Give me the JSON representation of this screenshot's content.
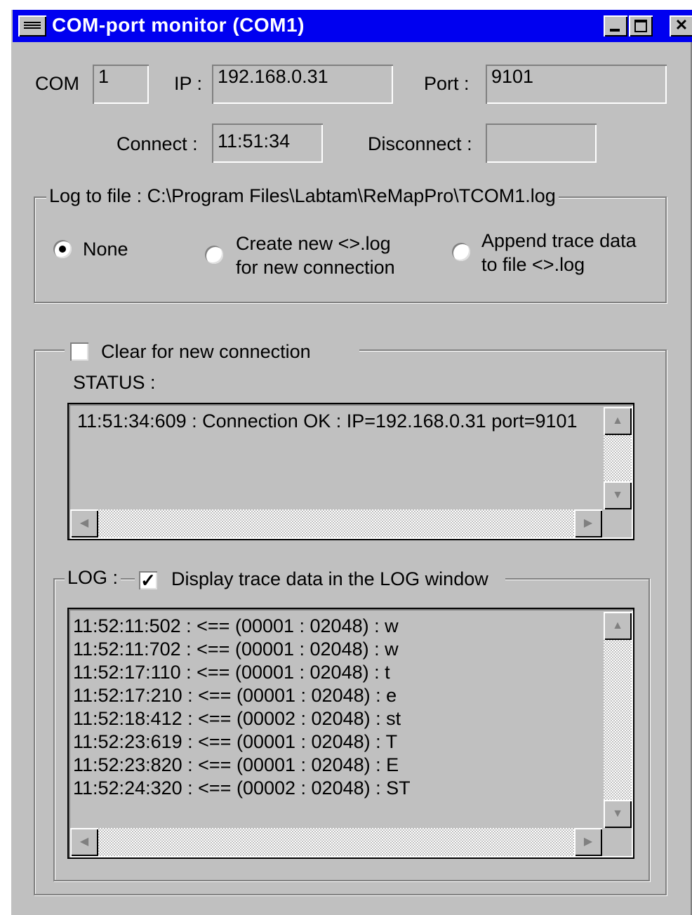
{
  "window": {
    "title": "COM-port monitor (COM1)",
    "controls": {
      "minimize": "_",
      "maximize": "□",
      "close": "✕"
    }
  },
  "connection": {
    "com_label": "COM",
    "com_value": "1",
    "ip_label": "IP :",
    "ip_value": "192.168.0.31",
    "port_label": "Port :",
    "port_value": "9101",
    "connect_label": "Connect :",
    "connect_value": "11:51:34",
    "disconnect_label": "Disconnect :",
    "disconnect_value": ""
  },
  "log_to_file": {
    "legend": "Log to file : C:\\Program Files\\Labtam\\ReMapPro\\TCOM1.log",
    "options": [
      {
        "line1": "None",
        "line2": "",
        "selected": true
      },
      {
        "line1": "Create new <>.log",
        "line2": "for new connection",
        "selected": false
      },
      {
        "line1": "Append trace data",
        "line2": "to file <>.log",
        "selected": false
      }
    ]
  },
  "status_section": {
    "clear_checkbox_label": "Clear for new connection",
    "clear_checked": false,
    "status_label": "STATUS :",
    "lines": [
      "11:51:34:609 : Connection OK : IP=192.168.0.31  port=9101"
    ]
  },
  "log_section": {
    "legend": "LOG :",
    "display_checkbox_label": "Display trace data in the LOG window",
    "display_checked": true,
    "lines": [
      "11:52:11:502 : <== (00001 : 02048) : w",
      "11:52:11:702 : <== (00001 : 02048) : w",
      "11:52:17:110 : <== (00001 : 02048) : t",
      "11:52:17:210 : <== (00001 : 02048) : e",
      "11:52:18:412 : <== (00002 : 02048) : st",
      "11:52:23:619 : <== (00001 : 02048) : T",
      "11:52:23:820 : <== (00001 : 02048) : E",
      "11:52:24:320 : <== (00002 : 02048) : ST"
    ]
  },
  "icons": {
    "system_menu": "system-menu-icon",
    "scroll_up": "▲",
    "scroll_down": "▼",
    "scroll_left": "◀",
    "scroll_right": "▶",
    "check": "✓"
  },
  "colors": {
    "titlebar": "#0000f0",
    "face": "#c0c0c0",
    "shadow": "#808080",
    "highlight": "#ffffff"
  }
}
